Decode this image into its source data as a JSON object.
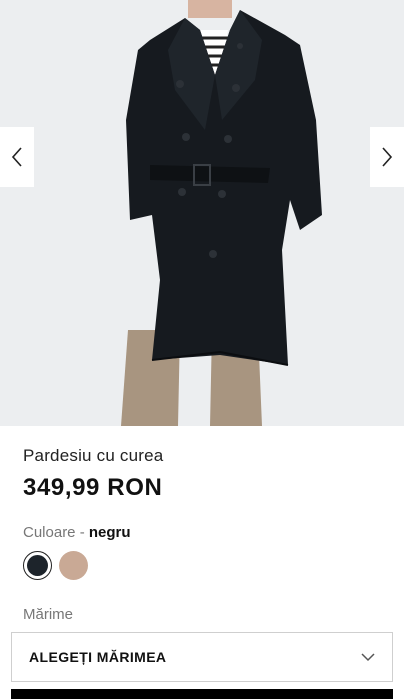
{
  "gallery": {
    "image_alt": "Black double-breasted belted trench coat worn over striped top and beige trousers",
    "prev_icon": "chevron-left-icon",
    "next_icon": "chevron-right-icon"
  },
  "product": {
    "title": "Pardesiu cu curea",
    "price": "349,99 RON"
  },
  "color": {
    "label": "Culoare",
    "separator": " - ",
    "selected": "negru",
    "swatches": [
      {
        "name": "negru",
        "hex": "#1d242b",
        "selected": true
      },
      {
        "name": "bej",
        "hex": "#c9a995",
        "selected": false
      }
    ]
  },
  "size": {
    "label": "Mărime",
    "select_text": "ALEGEȚI MĂRIMEA",
    "icon": "chevron-down-icon"
  },
  "colors": {
    "coat": "#161a1f",
    "background": "#eceef0",
    "trousers": "#a89580"
  }
}
